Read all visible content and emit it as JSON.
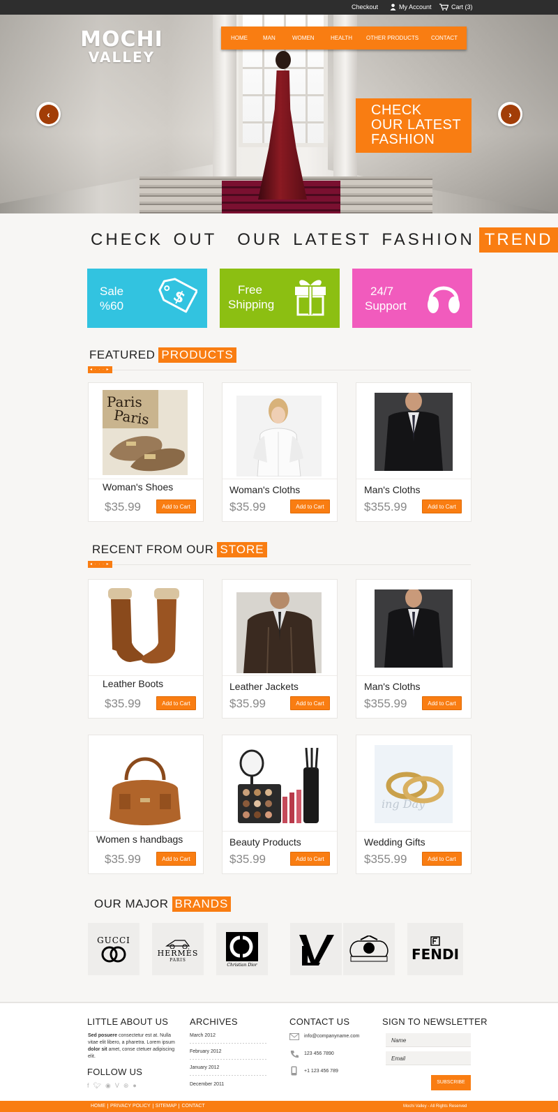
{
  "topbar": {
    "checkout": "Checkout",
    "account": "My Account",
    "cart": "Cart (3)"
  },
  "logo": {
    "line1": "MOCHI",
    "line2": "VALLEY"
  },
  "nav": [
    "HOME",
    "MAN",
    "WOMEN",
    "HEALTH",
    "OTHER PRODUCTS",
    "CONTACT"
  ],
  "hero": {
    "cta": [
      "CHECK",
      "OUR LATEST",
      "FASHION"
    ],
    "prev_icon": "chevron-left-icon",
    "next_icon": "chevron-right-icon"
  },
  "headline": {
    "text": "CHECK OUT  OUR LATEST FASHION",
    "highlight": "TREND"
  },
  "promos": [
    {
      "line1": "Sale",
      "line2": "%60",
      "color": "#32c3e0",
      "icon": "price-tag-icon"
    },
    {
      "line1": "Free",
      "line2": "Shipping",
      "color": "#8cbf12",
      "icon": "gift-box-icon"
    },
    {
      "line1": "24/7",
      "line2": "Support",
      "color": "#f15bbd",
      "icon": "headphones-icon"
    }
  ],
  "featured": {
    "title": "FEATURED",
    "highlight": "PRODUCTS",
    "pager": "◂ · · · ▸",
    "products": [
      {
        "name": "Woman's Shoes",
        "price": "$35.99",
        "button": "Add to Cart"
      },
      {
        "name": "Woman's Cloths",
        "price": "$35.99",
        "button": "Add to Cart"
      },
      {
        "name": "Man's Cloths",
        "price": "$355.99",
        "button": "Add to Cart"
      }
    ]
  },
  "recent": {
    "title": "RECENT FROM OUR",
    "highlight": "STORE",
    "pager": "◂ · · · ▸",
    "products": [
      {
        "name": "Leather Boots",
        "price": "$35.99",
        "button": "Add to Cart"
      },
      {
        "name": "Leather Jackets",
        "price": "$35.99",
        "button": "Add to Cart"
      },
      {
        "name": "Man's Cloths",
        "price": "$355.99",
        "button": "Add to Cart"
      },
      {
        "name": "Women s handbags",
        "price": "$35.99",
        "button": "Add to Cart"
      },
      {
        "name": "Beauty Products",
        "price": "$35.99",
        "button": "Add to Cart"
      },
      {
        "name": "Wedding Gifts",
        "price": "$355.99",
        "button": "Add to Cart"
      }
    ]
  },
  "brands": {
    "title": "OUR MAJOR",
    "highlight": "BRANDS",
    "items": [
      {
        "name": "GUCCI"
      },
      {
        "name": "HERMÈS",
        "sub": "PARIS"
      },
      {
        "name": "Christian Dior"
      },
      {
        "name": "LOUIS VUITTON"
      },
      {
        "name": "JUICY COUTURE"
      },
      {
        "name": "FENDI"
      }
    ]
  },
  "footer": {
    "about": {
      "title": "LITTLE ABOUT US",
      "text_bold1": "Sed posuere",
      "text1": " consectetur  est at. Nulla vitae elit libero, a pharetra. Lorem ipsum ",
      "text_bold2": "dolor sit",
      "text2": " amet, conse ctetuer adipiscing elit."
    },
    "follow": {
      "title": "FOLLOW US"
    },
    "archives": {
      "title": "ARCHIVES",
      "items": [
        "March 2012",
        "February 2012",
        "January 2012",
        "December 2011"
      ]
    },
    "contact": {
      "title": "CONTACT US",
      "email": "info@companyname.com",
      "phone": "123 456 7890",
      "mobile": "+1 123 456 789"
    },
    "newsletter": {
      "title": "SIGN TO NEWSLETTER",
      "name_placeholder": "Name",
      "email_placeholder": "Email",
      "button": "SUBSCRIBE"
    }
  },
  "bottombar": {
    "links": [
      "HOME",
      "PRIVACY POLICY",
      "SITEMAP",
      "CONTACT"
    ],
    "copyright": "Mochi Valley - All Rights Reserved"
  },
  "colors": {
    "accent": "#f97d12",
    "topbar": "#2e2e2e",
    "arrow": "#a23d07"
  }
}
